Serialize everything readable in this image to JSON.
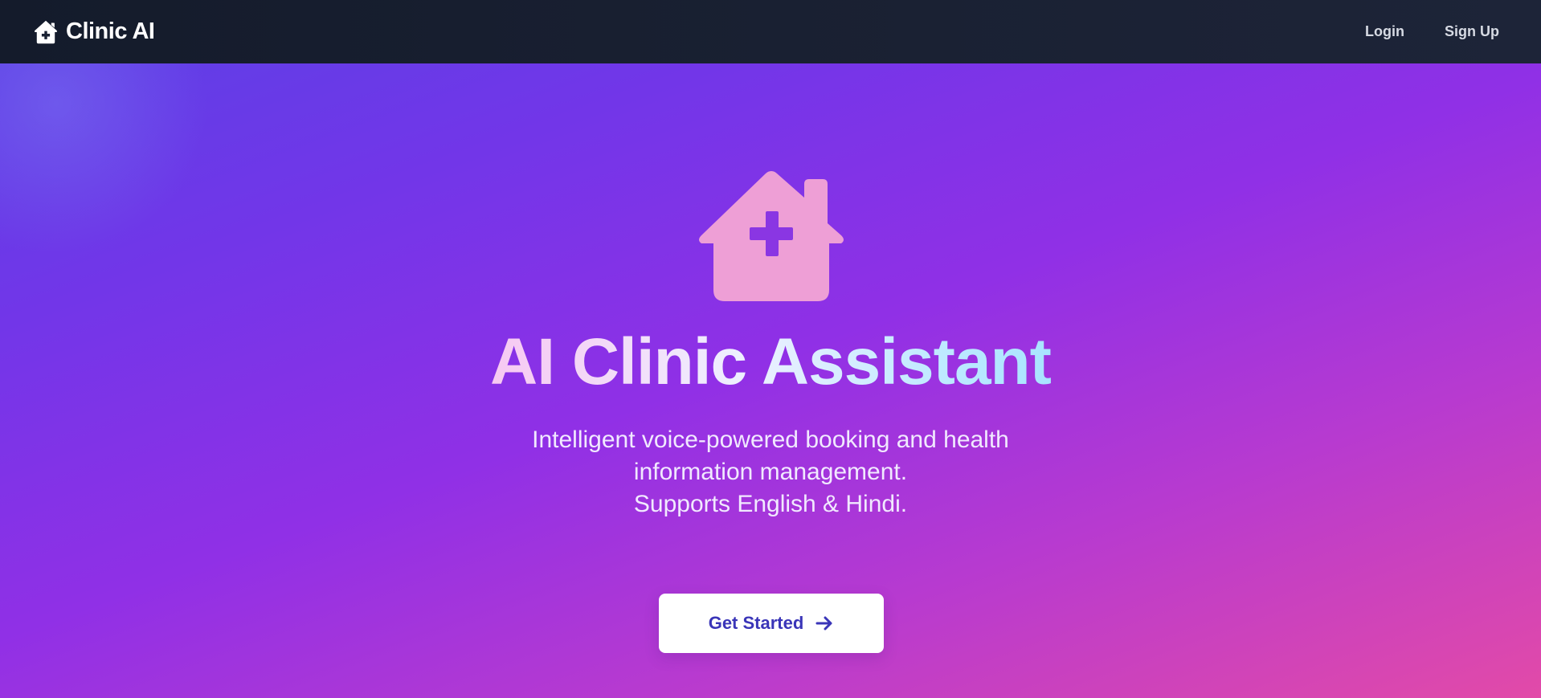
{
  "navbar": {
    "brand": "Clinic AI",
    "brand_icon": "house-medical-icon",
    "links": {
      "login": "Login",
      "signup": "Sign Up"
    }
  },
  "hero": {
    "icon": "house-medical-icon",
    "title": "AI Clinic Assistant",
    "subtitle_lines": [
      "Intelligent voice-powered booking and health",
      "information management.",
      "Supports English & Hindi."
    ],
    "cta_label": "Get Started",
    "cta_icon": "arrow-right-icon"
  },
  "colors": {
    "navbar_bg": "#151c2c",
    "hero_gradient_start": "#5e3fe6",
    "hero_gradient_mid": "#9030e6",
    "hero_gradient_end": "#e24aa8",
    "hero_icon": "#ee9fd6",
    "cta_text": "#3a35b8"
  }
}
